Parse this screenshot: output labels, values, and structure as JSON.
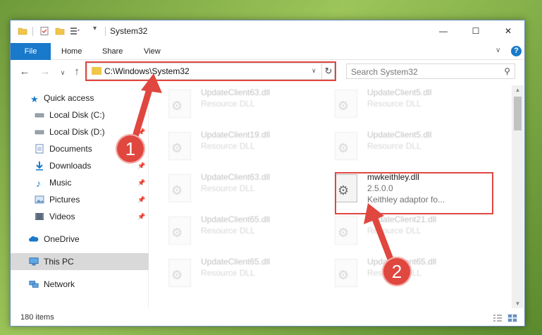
{
  "window": {
    "title": "System32",
    "controls": {
      "minimize": "—",
      "maximize": "☐",
      "close": "✕"
    }
  },
  "ribbon": {
    "tabs": [
      {
        "label": "File"
      },
      {
        "label": "Home"
      },
      {
        "label": "Share"
      },
      {
        "label": "View"
      }
    ],
    "help": "?"
  },
  "address": {
    "path": "C:\\Windows\\System32",
    "refresh": "↻"
  },
  "search": {
    "placeholder": "Search System32"
  },
  "nav": {
    "items": [
      {
        "label": "Quick access",
        "icon": "star-icon"
      },
      {
        "label": "Local Disk (C:)",
        "icon": "drive-icon",
        "pinned": true
      },
      {
        "label": "Local Disk (D:)",
        "icon": "drive-icon",
        "pinned": true
      },
      {
        "label": "Documents",
        "icon": "documents-icon",
        "pinned": true
      },
      {
        "label": "Downloads",
        "icon": "download-icon",
        "pinned": true
      },
      {
        "label": "Music",
        "icon": "music-icon",
        "pinned": true
      },
      {
        "label": "Pictures",
        "icon": "pictures-icon",
        "pinned": true
      },
      {
        "label": "Videos",
        "icon": "videos-icon",
        "pinned": true
      },
      {
        "label": "OneDrive",
        "icon": "cloud-icon"
      },
      {
        "label": "This PC",
        "icon": "computer-icon",
        "selected": true
      },
      {
        "label": "Network",
        "icon": "network-icon"
      }
    ]
  },
  "files": [
    {
      "name": "UpdateClient63.dll",
      "desc": "Resource DLL"
    },
    {
      "name": "UpdateClient5.dll",
      "desc": "Resource DLL"
    },
    {
      "name": "UpdateClient19.dll",
      "desc": "Resource DLL"
    },
    {
      "name": "UpdateClient5.dll",
      "desc": "Resource DLL"
    },
    {
      "name": "UpdateClient63.dll",
      "desc": "Resource DLL"
    },
    {
      "name": "mwkeithley.dll",
      "version": "2.5.0.0",
      "desc": "Keithley adaptor fo..."
    },
    {
      "name": "UpdateClient65.dll",
      "desc": "Resource DLL"
    },
    {
      "name": "UpdateClient21.dll",
      "desc": "Resource DLL"
    },
    {
      "name": "UpdateClient65.dll",
      "desc": "Resource DLL"
    },
    {
      "name": "UpdateClient65.dll",
      "desc": "Resource DLL"
    }
  ],
  "status": {
    "item_count": "180 items"
  },
  "annotations": [
    {
      "label": "1"
    },
    {
      "label": "2"
    }
  ],
  "colors": {
    "accent": "#1979ca",
    "highlight": "#e0473f",
    "folder": "#f0c648"
  }
}
